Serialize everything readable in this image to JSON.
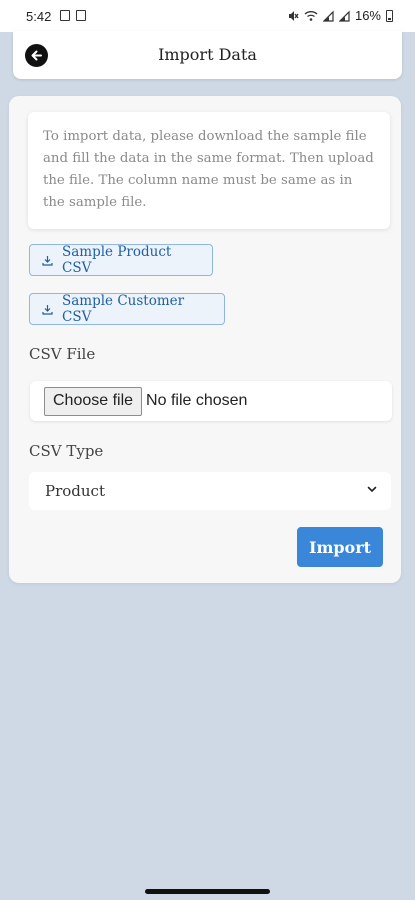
{
  "status_bar": {
    "time": "5:42",
    "left_icons": [
      "image-icon",
      "notification-icon"
    ],
    "right_icons": [
      "mute-icon",
      "wifi-icon",
      "signal-icon",
      "signal-icon"
    ],
    "battery": "16%"
  },
  "header": {
    "title": "Import Data",
    "back_icon": "arrow-left-circle-icon"
  },
  "info": {
    "text": "To import data, please download the sample file and fill the data in the same format. Then upload the file. The column name must be same as in the sample file."
  },
  "samples": {
    "product_label": "Sample Product CSV",
    "customer_label": "Sample Customer CSV",
    "icon": "download-icon"
  },
  "csv_file": {
    "label": "CSV File",
    "choose_label": "Choose file",
    "status": "No file chosen"
  },
  "csv_type": {
    "label": "CSV Type",
    "selected": "Product"
  },
  "actions": {
    "import_label": "Import"
  },
  "colors": {
    "background": "#cfd9e5",
    "accent": "#3a87d9",
    "link": "#1f5fa3"
  }
}
